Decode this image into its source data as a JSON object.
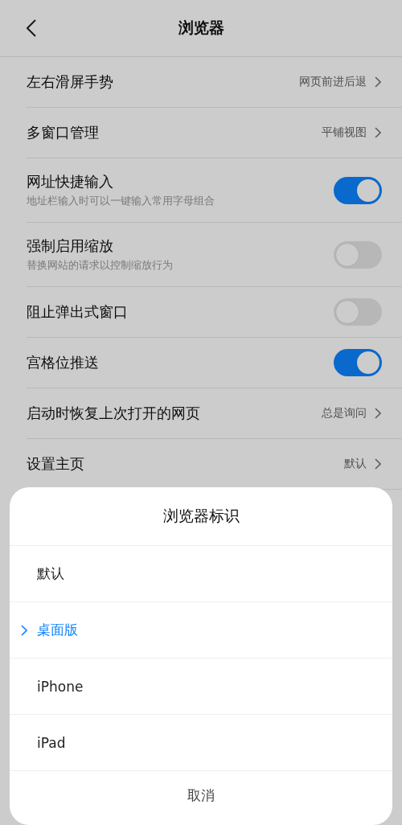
{
  "header": {
    "title": "浏览器"
  },
  "settings": [
    {
      "kind": "link",
      "title": "左右滑屏手势",
      "value": "网页前进后退"
    },
    {
      "kind": "link",
      "title": "多窗口管理",
      "value": "平铺视图"
    },
    {
      "kind": "toggle",
      "title": "网址快捷输入",
      "subtitle": "地址栏输入时可以一键输入常用字母组合",
      "on": true
    },
    {
      "kind": "toggle",
      "title": "强制启用缩放",
      "subtitle": "替换网站的请求以控制缩放行为",
      "on": false
    },
    {
      "kind": "toggle",
      "title": "阻止弹出式窗口",
      "on": false
    },
    {
      "kind": "toggle",
      "title": "宫格位推送",
      "on": true
    },
    {
      "kind": "link",
      "title": "启动时恢复上次打开的网页",
      "value": "总是询问"
    },
    {
      "kind": "link",
      "title": "设置主页",
      "value": "默认"
    }
  ],
  "dialog": {
    "title": "浏览器标识",
    "options": [
      {
        "label": "默认",
        "selected": false
      },
      {
        "label": "桌面版",
        "selected": true
      },
      {
        "label": "iPhone",
        "selected": false
      },
      {
        "label": "iPad",
        "selected": false
      }
    ],
    "cancel": "取消"
  }
}
